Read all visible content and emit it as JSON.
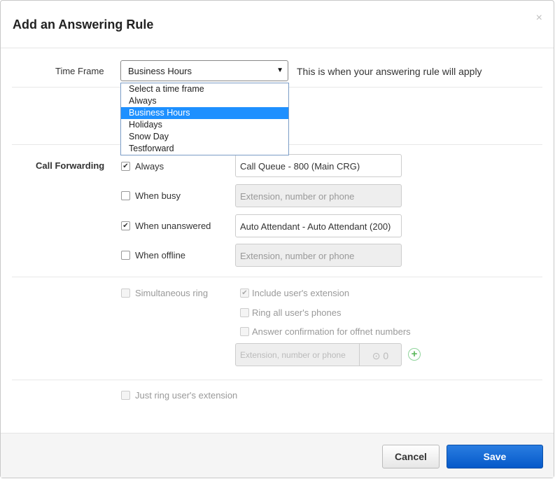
{
  "dialog": {
    "title": "Add an Answering Rule",
    "close_glyph": "×"
  },
  "time_frame": {
    "label": "Time Frame",
    "selected": "Business Hours",
    "caret": "▼",
    "hint": "This is when your answering rule will apply",
    "options": [
      "Select a time frame",
      "Always",
      "Business Hours",
      "Holidays",
      "Snow Day",
      "Testforward"
    ],
    "selected_index": 2
  },
  "call_forwarding": {
    "label": "Call Forwarding",
    "rows": [
      {
        "label": "Always",
        "checked": true,
        "value": "Call Queue - 800 (Main CRG)",
        "placeholder": "Extension, number or phone",
        "disabled": false
      },
      {
        "label": "When busy",
        "checked": false,
        "value": "",
        "placeholder": "Extension, number or phone",
        "disabled": true
      },
      {
        "label": "When unanswered",
        "checked": true,
        "value": "Auto Attendant - Auto Attendant (200)",
        "placeholder": "Extension, number or phone",
        "disabled": false
      },
      {
        "label": "When offline",
        "checked": false,
        "value": "",
        "placeholder": "Extension, number or phone",
        "disabled": true
      }
    ]
  },
  "simultaneous": {
    "label": "Simultaneous ring",
    "include_ext": "Include user's extension",
    "ring_all": "Ring all user's phones",
    "answer_conf": "Answer confirmation for offnet numbers",
    "input_placeholder": "Extension, number or phone",
    "delay_icon": "⊙",
    "delay_value": "0",
    "add_glyph": "+"
  },
  "just_ring": {
    "label": "Just ring user's extension"
  },
  "footer": {
    "cancel_label": "Cancel",
    "save_label": "Save"
  },
  "colors": {
    "accent": "#1e90ff",
    "save_bg": "#0a5fd0",
    "add_green": "#5cb85c"
  }
}
